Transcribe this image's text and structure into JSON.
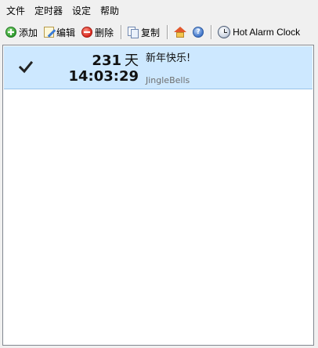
{
  "menu": {
    "items": [
      "文件",
      "定时器",
      "设定",
      "帮助"
    ]
  },
  "toolbar": {
    "add_label": "添加",
    "edit_label": "编辑",
    "delete_label": "删除",
    "copy_label": "复制",
    "help_glyph": "?",
    "brand_label": "Hot Alarm Clock",
    "icons": {
      "add": "add-icon",
      "edit": "edit-icon",
      "delete": "delete-icon",
      "copy": "copy-icon",
      "home": "home-icon",
      "help": "help-icon",
      "brand": "alarm-clock-icon"
    }
  },
  "alarms": [
    {
      "enabled": true,
      "days": "231",
      "days_unit": "天",
      "time": "14:03:29",
      "title": "新年快乐!",
      "sound": "JingleBells"
    }
  ],
  "colors": {
    "selected_row": "#cde8ff",
    "window_bg": "#f0f0f0"
  }
}
